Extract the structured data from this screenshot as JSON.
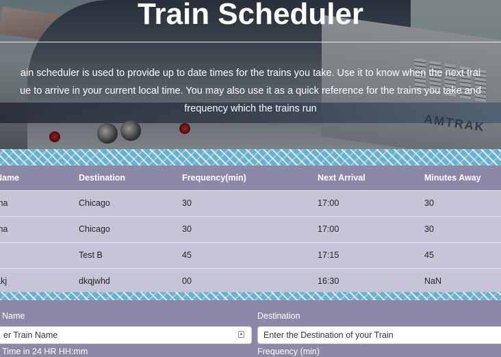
{
  "hero": {
    "title": "Train Scheduler",
    "description_lines": [
      "ain scheduler is used to provide up to date times for the trains you take. Use it to know when the next trai",
      "ue to arrive in your current local time. You may also use it as a quick reference for the trains you take and",
      "frequency which the trains run"
    ],
    "amtrak_logo": "AMTRAK"
  },
  "table": {
    "headers": [
      "Name",
      "Destination",
      "Frequency(min)",
      "Next Arrival",
      "Minutes Away"
    ],
    "rows": [
      [
        "tha",
        "Chicago",
        "30",
        "17:00",
        "30"
      ],
      [
        "tha",
        "Chicago",
        "30",
        "17:00",
        "30"
      ],
      [
        "",
        "Test B",
        "45",
        "17:15",
        "45"
      ],
      [
        "akj",
        "dkqjwhd",
        "00",
        "16:30",
        "NaN"
      ]
    ]
  },
  "form": {
    "name_label": "Name",
    "name_placeholder": "er Train Name",
    "destination_label": "Destination",
    "destination_placeholder": "Enter the Destination of your Train",
    "time_label": "Time in 24 HR HH:mm",
    "frequency_label": "Frequency (min)"
  },
  "colors": {
    "header_bg": "#8e88a8",
    "row_bg": "#c8c4d8",
    "band": "#6ab0cf"
  }
}
